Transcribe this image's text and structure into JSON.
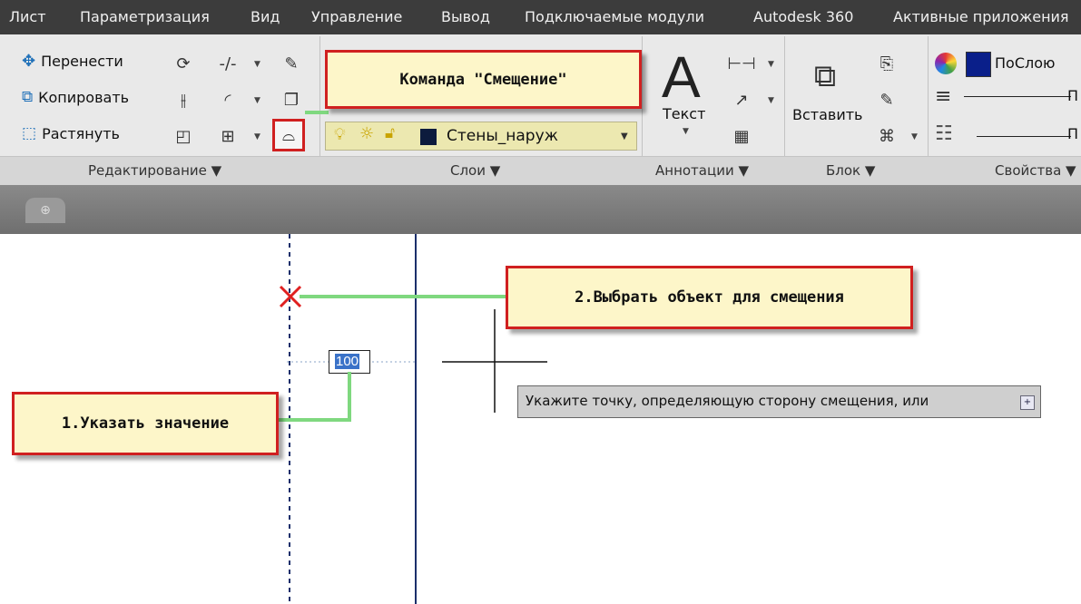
{
  "menu": {
    "items": [
      "Лист",
      "Параметризация",
      "Вид",
      "Управление",
      "Вывод",
      "Подключаемые модули",
      "Autodesk 360",
      "Активные приложения"
    ]
  },
  "ribbon": {
    "edit_panel": {
      "move_label": "Перенести",
      "copy_label": "Копировать",
      "stretch_label": "Растянуть",
      "title": "Редактирование ▼"
    },
    "layers_panel": {
      "layer_name": "Стены_наруж",
      "title": "Слои ▼"
    },
    "annotation_panel": {
      "text_label": "Текст",
      "title": "Аннотации ▼"
    },
    "block_panel": {
      "insert_label": "Вставить",
      "title": "Блок ▼"
    },
    "properties_panel": {
      "color_value": "ПоСлою",
      "line1_suffix": "П",
      "line2_suffix": "П",
      "title": "Свойства ▼"
    }
  },
  "callouts": {
    "offset_command": "Команда \"Смещение\"",
    "select_object": "2.Выбрать объект для смещения",
    "enter_value": "1.Указать значение"
  },
  "drawing": {
    "input_value": "100",
    "tooltip": "Укажите точку, определяющую сторону смещения, или"
  },
  "colors": {
    "menubar": "#3c3c3c",
    "callout_border": "#d02020",
    "callout_fill": "#fdf6c9",
    "leader": "#7fd87f",
    "layer_swatch": "#0d1b3d"
  }
}
